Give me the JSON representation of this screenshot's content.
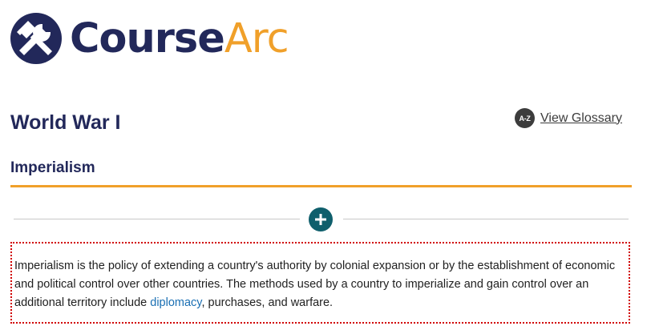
{
  "brand": {
    "name_part1": "Course",
    "name_part2": "Arc",
    "colors": {
      "navy": "#22285a",
      "orange": "#f0a02a"
    },
    "logo_icon": "hammer-wrench-icon"
  },
  "page": {
    "title": "World War I"
  },
  "glossary": {
    "badge": "A-Z",
    "link_label": "View Glossary"
  },
  "section": {
    "title": "Imperialism",
    "accent_color": "#f0a02a"
  },
  "expand": {
    "icon": "plus-icon",
    "color": "#0f5f6c"
  },
  "content": {
    "text_before": "Imperialism is the policy of extending a country's authority by colonial expansion or by the establishment of economic and political control over other countries. The methods used by a country to imperialize and gain control over an additional territory include ",
    "term": "diplomacy",
    "text_after": ", purchases, and warfare.",
    "border_color": "#d10000",
    "link_color": "#1a6fb3"
  }
}
